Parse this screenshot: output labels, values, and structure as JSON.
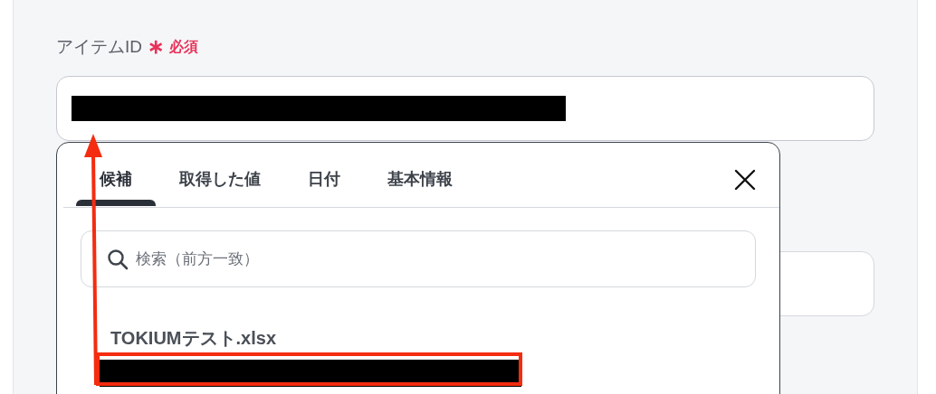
{
  "field": {
    "label": "アイテムID",
    "required_mark": "∗",
    "required_text": "必須"
  },
  "picker": {
    "tabs": [
      {
        "label": "候補",
        "selected": true
      },
      {
        "label": "取得した値",
        "selected": false
      },
      {
        "label": "日付",
        "selected": false
      },
      {
        "label": "基本情報",
        "selected": false
      }
    ],
    "search": {
      "placeholder": "検索（前方一致）"
    },
    "items": [
      {
        "title": "TOKIUMテスト.xlsx"
      }
    ]
  }
}
